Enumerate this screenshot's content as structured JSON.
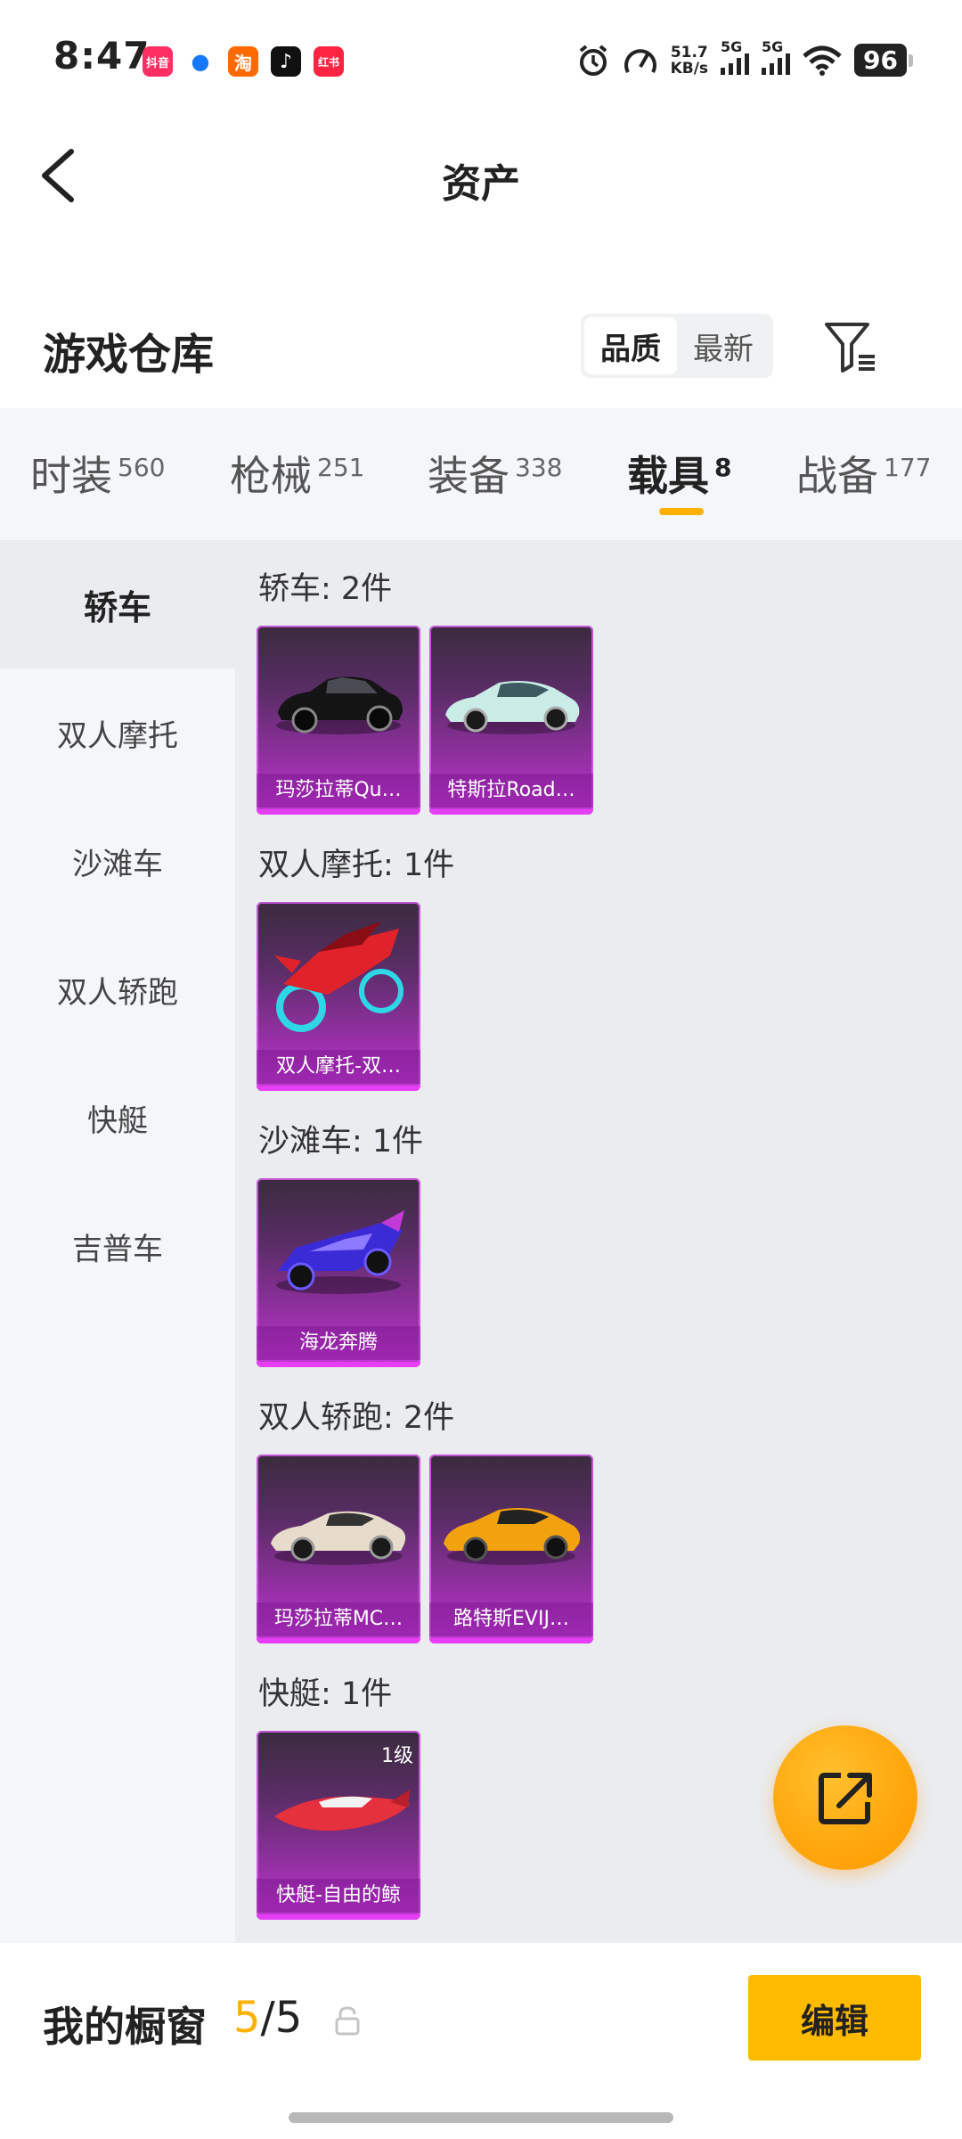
{
  "status_bar": {
    "time": "8:47",
    "apps": [
      {
        "label": "抖音",
        "color": "#ff2e63",
        "icon": "app-douyin-mall-icon"
      },
      {
        "label": "●",
        "color": "#1677ff",
        "icon": "app-blue-icon"
      },
      {
        "label": "淘",
        "color": "#ff6a00",
        "icon": "app-taobao-icon"
      },
      {
        "label": "♪",
        "color": "#111111",
        "icon": "app-tiktok-icon"
      },
      {
        "label": "红书",
        "color": "#ff2442",
        "icon": "app-xiaohongshu-icon"
      }
    ],
    "speed_value": "51.7",
    "speed_unit": "KB/s",
    "net1": "5G",
    "net2": "5G",
    "battery": "96"
  },
  "header": {
    "title": "资产"
  },
  "section": {
    "title": "游戏仓库",
    "sort_options": [
      "品质",
      "最新"
    ],
    "sort_selected": "品质"
  },
  "tabs": [
    {
      "label": "时装",
      "count": "560"
    },
    {
      "label": "枪械",
      "count": "251"
    },
    {
      "label": "装备",
      "count": "338"
    },
    {
      "label": "载具",
      "count": "8",
      "active": true
    },
    {
      "label": "战备",
      "count": "177"
    }
  ],
  "sidebar": {
    "items": [
      "轿车",
      "双人摩托",
      "沙滩车",
      "双人轿跑",
      "快艇",
      "吉普车"
    ],
    "active": "轿车"
  },
  "groups": [
    {
      "title": "轿车: 2件",
      "items": [
        {
          "name": "玛莎拉蒂Qu…",
          "art": "black-sedan",
          "color": "#1a1a1a"
        },
        {
          "name": "特斯拉Road…",
          "art": "teal-roadster",
          "color": "#bfe3df"
        }
      ]
    },
    {
      "title": "双人摩托: 1件",
      "items": [
        {
          "name": "双人摩托-双…",
          "art": "red-motorbike",
          "color": "#e0232b"
        }
      ]
    },
    {
      "title": "沙滩车: 1件",
      "items": [
        {
          "name": "海龙奔腾",
          "art": "blue-buggy",
          "color": "#3a2bd6"
        }
      ]
    },
    {
      "title": "双人轿跑: 2件",
      "items": [
        {
          "name": "玛莎拉蒂MC…",
          "art": "cream-coupe",
          "color": "#e7dccb"
        },
        {
          "name": "路特斯EVIJ…",
          "art": "orange-coupe",
          "color": "#f2a20f"
        }
      ]
    },
    {
      "title": "快艇: 1件",
      "items": [
        {
          "name": "快艇-自由的鲸",
          "art": "red-speedboat",
          "color": "#e5303d",
          "level": "1级"
        }
      ]
    }
  ],
  "bottom": {
    "label": "我的橱窗",
    "count_used": "5",
    "count_sep": "/5",
    "edit_label": "编辑"
  },
  "colors": {
    "accent": "#ffb000",
    "card_purple": "#9a30aa"
  }
}
